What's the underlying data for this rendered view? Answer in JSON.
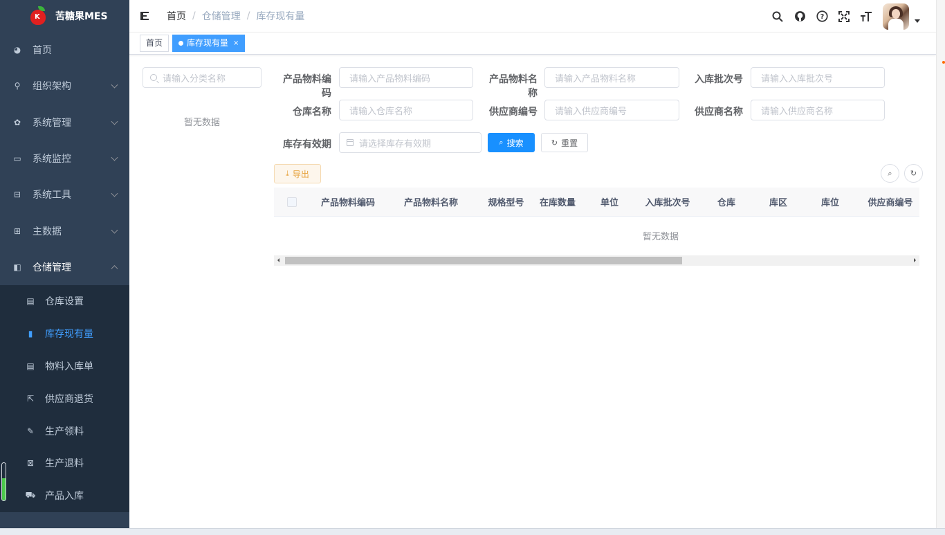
{
  "app": {
    "title": "苦糖果MES"
  },
  "sidebar": {
    "items": [
      {
        "label": "首页",
        "icon": "dashboard-icon",
        "has_children": false
      },
      {
        "label": "组织架构",
        "icon": "tree-icon",
        "has_children": true
      },
      {
        "label": "系统管理",
        "icon": "gear-icon",
        "has_children": true
      },
      {
        "label": "系统监控",
        "icon": "monitor-icon",
        "has_children": true
      },
      {
        "label": "系统工具",
        "icon": "toolbox-icon",
        "has_children": true
      },
      {
        "label": "主数据",
        "icon": "table-icon",
        "has_children": true
      },
      {
        "label": "仓储管理",
        "icon": "warehouse-icon",
        "has_children": true,
        "expanded": true
      }
    ],
    "sub_items": [
      {
        "label": "仓库设置",
        "icon": "book-icon"
      },
      {
        "label": "库存现有量",
        "icon": "bar-chart-icon",
        "active": true
      },
      {
        "label": "物料入库单",
        "icon": "document-icon"
      },
      {
        "label": "供应商退货",
        "icon": "external-link-icon"
      },
      {
        "label": "生产领料",
        "icon": "edit-icon"
      },
      {
        "label": "生产退料",
        "icon": "return-icon"
      },
      {
        "label": "产品入库",
        "icon": "cart-icon"
      }
    ]
  },
  "navbar": {
    "breadcrumb": [
      "首页",
      "仓储管理",
      "库存现有量"
    ],
    "icons": [
      "search-icon",
      "github-icon",
      "help-icon",
      "fullscreen-icon",
      "font-size-icon"
    ]
  },
  "tags": [
    {
      "label": "首页",
      "active": false
    },
    {
      "label": "库存现有量",
      "active": true,
      "close": "×"
    }
  ],
  "tree": {
    "search_placeholder": "请输入分类名称",
    "empty_text": "暂无数据"
  },
  "form": {
    "item_code": {
      "label": "产品物料编码",
      "placeholder": "请输入产品物料编码"
    },
    "item_name": {
      "label": "产品物料名称",
      "placeholder": "请输入产品物料名称"
    },
    "batch_code": {
      "label": "入库批次号",
      "placeholder": "请输入入库批次号"
    },
    "warehouse_name": {
      "label": "仓库名称",
      "placeholder": "请输入仓库名称"
    },
    "vendor_code": {
      "label": "供应商编号",
      "placeholder": "请输入供应商编号"
    },
    "vendor_name": {
      "label": "供应商名称",
      "placeholder": "请输入供应商名称"
    },
    "expire_date": {
      "label": "库存有效期",
      "placeholder": "请选择库存有效期"
    },
    "search_button": "搜索",
    "reset_button": "重置"
  },
  "toolbar": {
    "export_button": "导出"
  },
  "table": {
    "columns": [
      "产品物料编码",
      "产品物料名称",
      "规格型号",
      "在库数量",
      "单位",
      "入库批次号",
      "仓库",
      "库区",
      "库位",
      "供应商编号"
    ],
    "empty_text": "暂无数据",
    "horizontal_scroll_fraction": 0.62
  }
}
